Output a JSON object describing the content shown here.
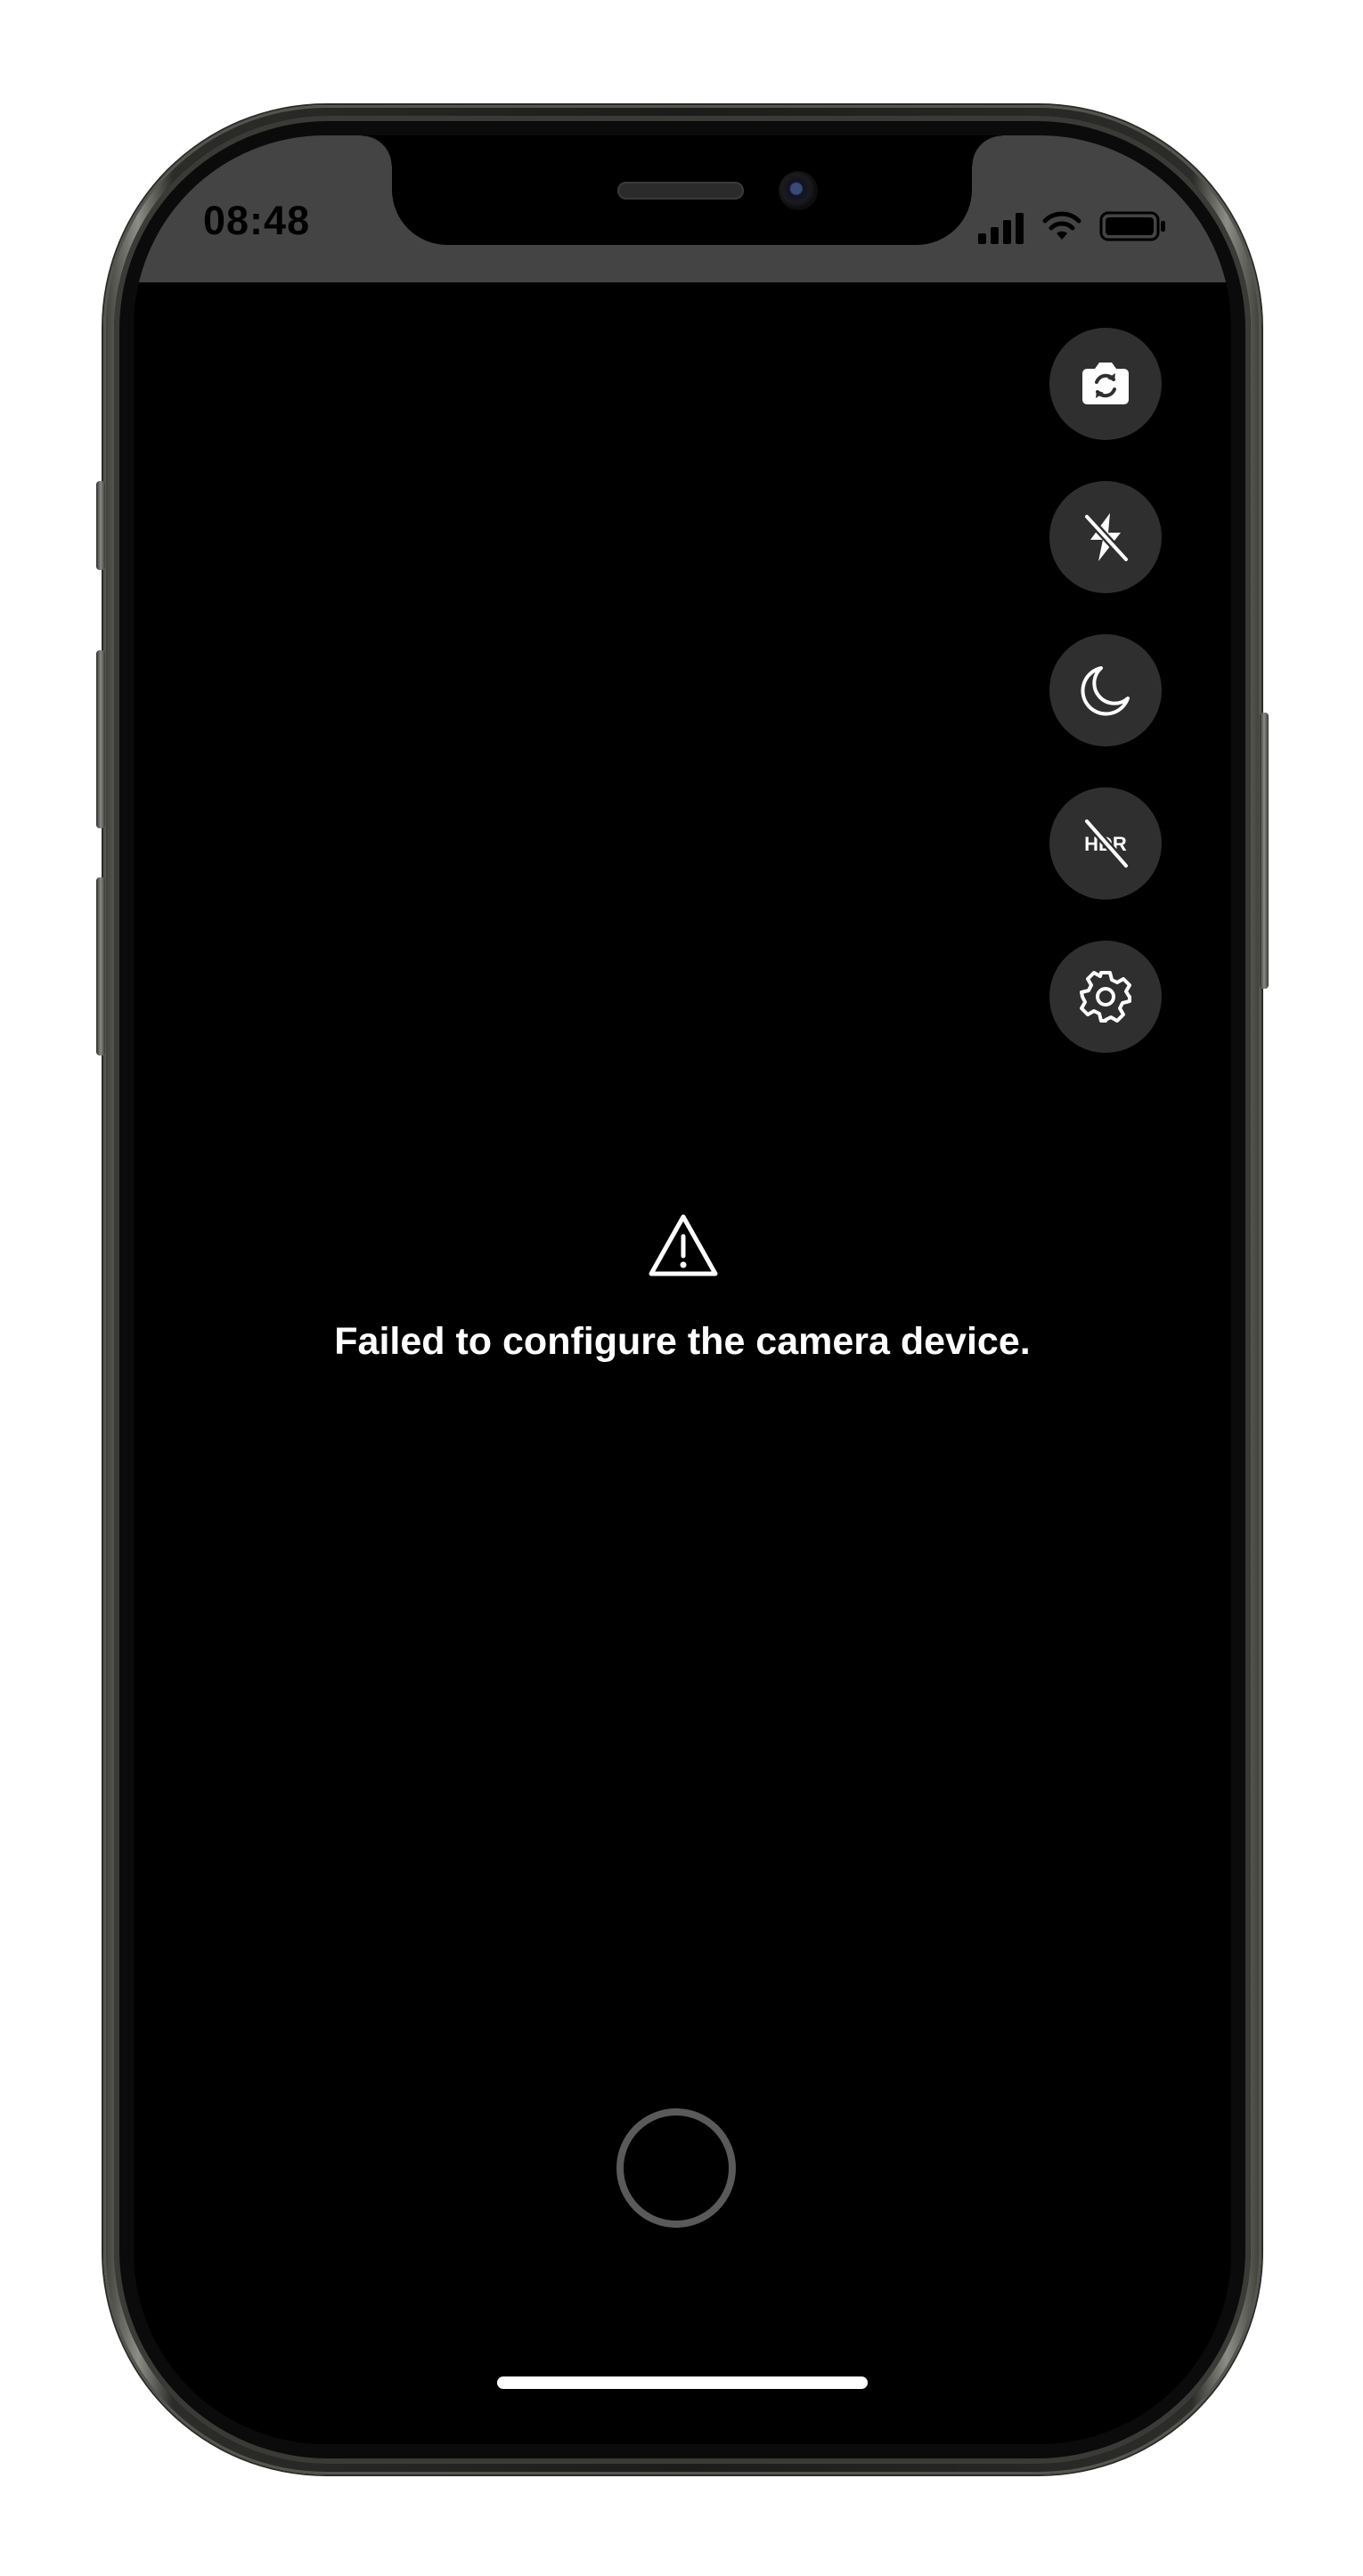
{
  "status_bar": {
    "time": "08:48",
    "icons": [
      "cellular-signal-icon",
      "wifi-icon",
      "battery-icon"
    ]
  },
  "controls": [
    {
      "name": "switch-camera-button",
      "icon": "camera-rotate-icon"
    },
    {
      "name": "flash-toggle-button",
      "icon": "flash-off-icon"
    },
    {
      "name": "night-mode-button",
      "icon": "moon-icon"
    },
    {
      "name": "hdr-toggle-button",
      "icon": "hdr-off-icon"
    },
    {
      "name": "settings-button",
      "icon": "gear-icon"
    }
  ],
  "error": {
    "icon": "warning-triangle-icon",
    "message": "Failed to configure the camera device."
  },
  "colors": {
    "status_bar_bg": "#444444",
    "screen_bg": "#000000",
    "control_bg": "#2f2f2f",
    "shutter_ring": "#5a5a5a",
    "text": "#ffffff"
  }
}
